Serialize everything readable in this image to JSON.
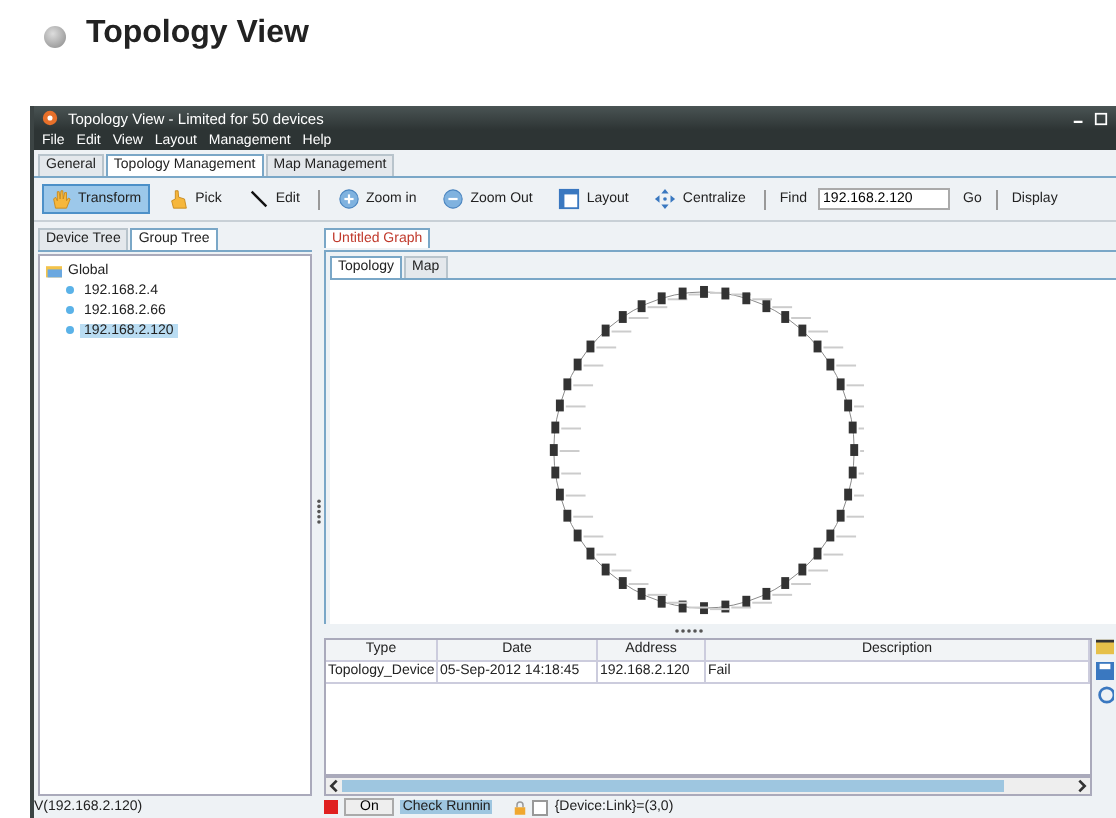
{
  "heading": "Topology View",
  "window": {
    "title": "Topology View - Limited for 50 devices"
  },
  "menu": [
    "File",
    "Edit",
    "View",
    "Layout",
    "Management",
    "Help"
  ],
  "app_tabs": [
    {
      "label": "General",
      "selected": false
    },
    {
      "label": "Topology Management",
      "selected": true
    },
    {
      "label": "Map Management",
      "selected": false
    }
  ],
  "toolbar": [
    {
      "label": "Transform",
      "kind": "hand",
      "selected": true
    },
    {
      "label": "Pick",
      "kind": "pointer",
      "selected": false
    },
    {
      "label": "Edit",
      "kind": "line",
      "selected": false
    },
    {
      "label": "Zoom in",
      "kind": "plus",
      "selected": false
    },
    {
      "label": "Zoom Out",
      "kind": "minus",
      "selected": false
    },
    {
      "label": "Layout",
      "kind": "layout",
      "selected": false
    },
    {
      "label": "Centralize",
      "kind": "arrows",
      "selected": false
    }
  ],
  "find": {
    "label": "Find",
    "value": "192.168.2.120"
  },
  "go": "Go",
  "display": "Display",
  "side_tabs": [
    {
      "label": "Device Tree",
      "selected": false
    },
    {
      "label": "Group Tree",
      "selected": true
    }
  ],
  "tree": {
    "label": "Global",
    "children": [
      {
        "label": "192.168.2.4",
        "selected": false
      },
      {
        "label": "192.168.2.66",
        "selected": false
      },
      {
        "label": "192.168.2.120",
        "selected": true
      }
    ]
  },
  "graph_tab": "Untitled Graph",
  "view_tabs": [
    {
      "label": "Topology",
      "selected": true
    },
    {
      "label": "Map",
      "selected": false
    }
  ],
  "table": {
    "columns": [
      "Type",
      "Date",
      "Address",
      "Description"
    ],
    "rows": [
      [
        "Topology_Device",
        "05-Sep-2012 14:18:45",
        "192.168.2.120",
        "Fail"
      ]
    ]
  },
  "status": {
    "left": "V(192.168.2.120)",
    "on": "On",
    "running": "Check Runnin",
    "counts": "{Device:Link}=(3,0)",
    "checked": false
  }
}
